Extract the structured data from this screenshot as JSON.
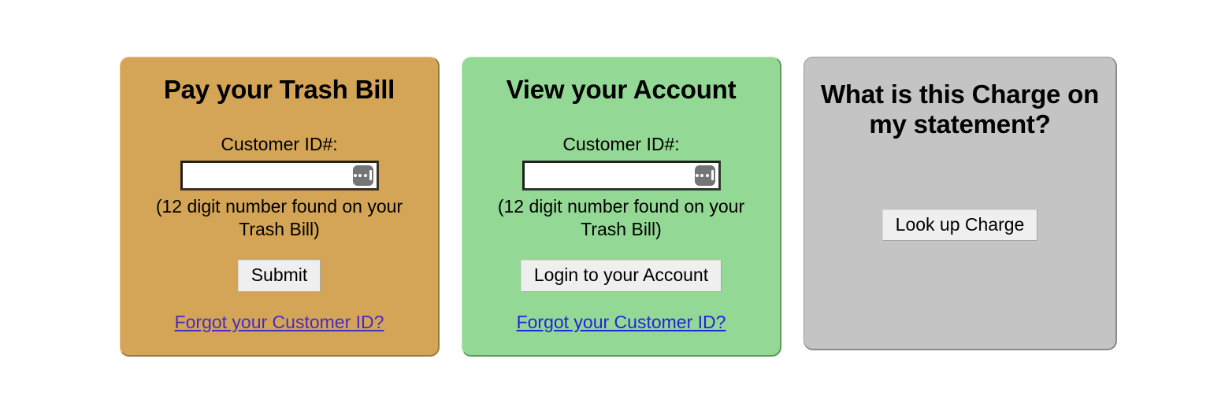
{
  "panels": [
    {
      "id": "pay-trash-bill",
      "title": "Pay your Trash Bill",
      "field_label": "Customer ID#:",
      "input_value": "",
      "input_placeholder": "",
      "autofill_icon": "autofill-dots-icon",
      "hint": "(12 digit number found on your Trash Bill)",
      "button_label": "Submit",
      "link_label": "Forgot your Customer ID?",
      "background_color": "#d4a556",
      "link_color": "#4a2bc0"
    },
    {
      "id": "view-your-account",
      "title": "View your Account",
      "field_label": "Customer ID#:",
      "input_value": "",
      "input_placeholder": "",
      "autofill_icon": "autofill-dots-icon",
      "hint": "(12 digit number found on your Trash Bill)",
      "button_label": "Login to your Account",
      "link_label": "Forgot your Customer ID?",
      "background_color": "#93d894",
      "link_color": "#2323dd"
    },
    {
      "id": "what-is-this-charge",
      "title": "What is this Charge on my statement?",
      "button_label": "Look up Charge",
      "background_color": "#c4c4c4"
    }
  ]
}
